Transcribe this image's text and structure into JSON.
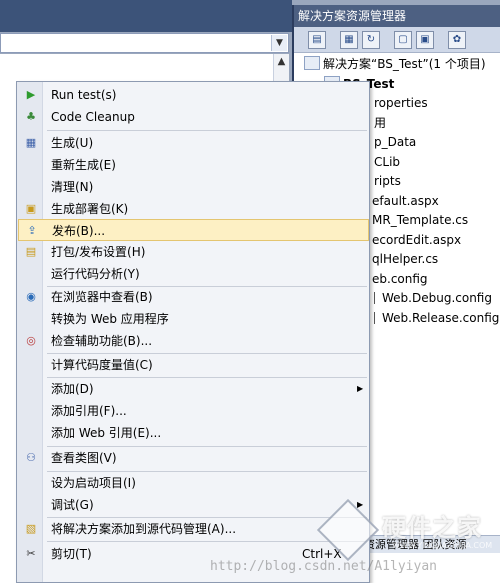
{
  "solution_explorer": {
    "title": "解决方案资源管理器",
    "tree": [
      "解决方案“BS_Test”(1 个项目)",
      "BS_Test",
      "roperties",
      "用",
      "p_Data",
      "CLib",
      "ripts",
      "efault.aspx",
      "MR_Template.cs",
      "ecordEdit.aspx",
      "qlHelper.cs",
      "eb.config",
      "Web.Debug.config",
      "Web.Release.config"
    ],
    "bottom_tabs": "资源管理器   团队资源"
  },
  "context_menu": {
    "items": [
      {
        "label": "Run test(s)",
        "icon": "play-icon"
      },
      {
        "label": "Code Cleanup",
        "icon": "broom-icon"
      },
      {
        "label": "生成(U)",
        "icon": "build-icon"
      },
      {
        "label": "重新生成(E)",
        "icon": ""
      },
      {
        "label": "清理(N)",
        "icon": ""
      },
      {
        "label": "生成部署包(K)",
        "icon": "package-icon"
      },
      {
        "label": "发布(B)...",
        "icon": "publish-icon",
        "highlighted": true
      },
      {
        "label": "打包/发布设置(H)",
        "icon": "package-settings-icon"
      },
      {
        "label": "运行代码分析(Y)",
        "icon": ""
      },
      {
        "label": "在浏览器中查看(B)",
        "icon": "browser-icon"
      },
      {
        "label": "转换为 Web 应用程序",
        "icon": ""
      },
      {
        "label": "检查辅助功能(B)...",
        "icon": "accessibility-icon"
      },
      {
        "label": "计算代码度量值(C)",
        "icon": ""
      },
      {
        "label": "添加(D)",
        "icon": "",
        "submenu": true
      },
      {
        "label": "添加引用(F)...",
        "icon": ""
      },
      {
        "label": "添加 Web 引用(E)...",
        "icon": ""
      },
      {
        "label": "查看类图(V)",
        "icon": "class-diagram-icon"
      },
      {
        "label": "设为启动项目(I)",
        "icon": ""
      },
      {
        "label": "调试(G)",
        "icon": "",
        "submenu": true
      },
      {
        "label": "将解决方案添加到源代码管理(A)...",
        "icon": "source-control-icon"
      },
      {
        "label": "剪切(T)",
        "icon": "scissors-icon",
        "shortcut": "Ctrl+X"
      }
    ]
  },
  "watermark": {
    "title": "硬件之家",
    "subtitle": "WWW.YINGJIAZHIJIA.COM",
    "url": "http://blog.csdn.net/A1lyiyan"
  }
}
